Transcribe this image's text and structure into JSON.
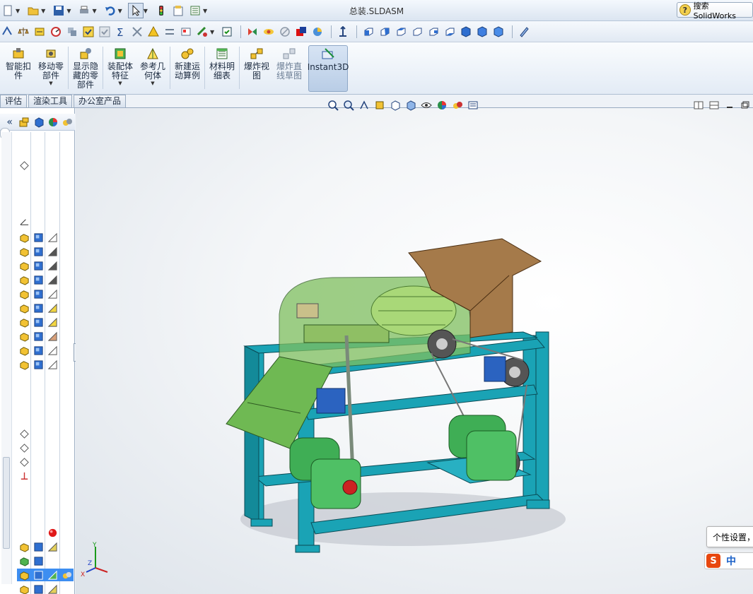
{
  "window": {
    "title": "总装.SLDASM"
  },
  "search": {
    "label": "搜索 SolidWorks"
  },
  "command_manager": {
    "commands": [
      {
        "label": "智能扣\n件",
        "has_menu": false
      },
      {
        "label": "移动零\n部件",
        "has_menu": true
      },
      {
        "label": "显示隐\n藏的零\n部件",
        "has_menu": false
      },
      {
        "label": "装配体\n特征",
        "has_menu": true
      },
      {
        "label": "参考几\n何体",
        "has_menu": true
      },
      {
        "label": "新建运\n动算例",
        "has_menu": false
      },
      {
        "label": "材料明\n细表",
        "has_menu": false
      },
      {
        "label": "爆炸视\n图",
        "has_menu": false
      },
      {
        "label": "爆炸直\n线草图",
        "has_menu": false
      },
      {
        "label": "Instant3D",
        "has_menu": false
      }
    ]
  },
  "tabs": [
    "评估",
    "渲染工具",
    "办公室产品"
  ],
  "tooltip": {
    "text": "个性设置，"
  },
  "ime": {
    "mode": "中"
  },
  "colors": {
    "frame": "#1aa3b5",
    "guard": "#7fbf5f",
    "hopper": "#a57a4a",
    "motor": "#3fae55",
    "accent": "#3d8ef1"
  }
}
